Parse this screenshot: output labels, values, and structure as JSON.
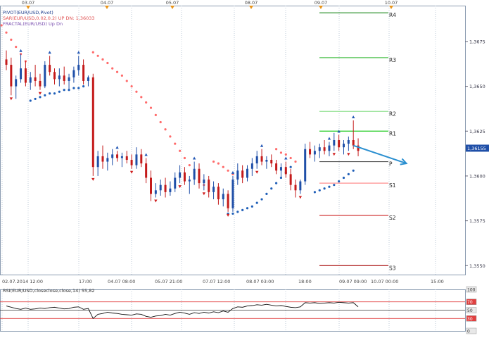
{
  "chart_data": {
    "type": "candlestick",
    "symbol": "EURUSD",
    "title_lines": [
      {
        "text": "PIVOT(EUR/USD,Pivot)",
        "color": "#1a3a8a"
      },
      {
        "text": "SAR(EUR/USD,0.02,0.2)   UP  DN: 1,36033",
        "color": "#e05050"
      },
      {
        "text": "FRACTAL(EUR/USD)  Up  Dn",
        "color": "#7a4fb0"
      }
    ],
    "top_dates": [
      "03.07",
      "04.07",
      "05.07",
      "08.07",
      "09.07",
      "10.07"
    ],
    "bottom_time_labels": [
      "02.07.2014 12:00",
      "17:00",
      "04.07 08:00",
      "05.07 21:00",
      "07.07 12:00",
      "08.07 03:00",
      "18:00",
      "09.07 09:00",
      "10.07 00:00",
      "15:00"
    ],
    "ylim": [
      1.3545,
      1.3695
    ],
    "y_ticks": [
      {
        "value": 1.3675,
        "label": "1,3675"
      },
      {
        "value": 1.365,
        "label": "1,3650"
      },
      {
        "value": 1.3625,
        "label": "1,3625"
      },
      {
        "value": 1.36,
        "label": "1,3600"
      },
      {
        "value": 1.3575,
        "label": "1,3575"
      },
      {
        "value": 1.355,
        "label": "1,3550"
      }
    ],
    "current_price": {
      "value": 1.36155,
      "label": "1,36155"
    },
    "pivot_levels": [
      {
        "name": "R4",
        "value": 1.3691,
        "color": "#1f8a1f"
      },
      {
        "name": "R3",
        "value": 1.3666,
        "color": "#4cc24c"
      },
      {
        "name": "R2",
        "value": 1.3636,
        "color": "#8fe08f"
      },
      {
        "name": "R1",
        "value": 1.3625,
        "color": "#22cc22"
      },
      {
        "name": "P",
        "value": 1.3608,
        "color": "#555555"
      },
      {
        "name": "S1",
        "value": 1.3596,
        "color": "#ff8f8f"
      },
      {
        "name": "S2",
        "value": 1.3578,
        "color": "#cc2222"
      },
      {
        "name": "S3",
        "value": 1.355,
        "color": "#aa1111"
      }
    ],
    "candles": [
      [
        1.3665,
        1.367,
        1.3659,
        1.3662
      ],
      [
        1.3662,
        1.3666,
        1.3645,
        1.365
      ],
      [
        1.365,
        1.3656,
        1.3643,
        1.3654
      ],
      [
        1.3654,
        1.3668,
        1.3652,
        1.366
      ],
      [
        1.366,
        1.3664,
        1.365,
        1.3652
      ],
      [
        1.3652,
        1.3658,
        1.3648,
        1.3655
      ],
      [
        1.3655,
        1.3662,
        1.365,
        1.3653
      ],
      [
        1.3653,
        1.3657,
        1.3648,
        1.365
      ],
      [
        1.365,
        1.3664,
        1.3649,
        1.3662
      ],
      [
        1.3662,
        1.3667,
        1.3656,
        1.3658
      ],
      [
        1.3658,
        1.366,
        1.3651,
        1.3654
      ],
      [
        1.3654,
        1.366,
        1.365,
        1.3656
      ],
      [
        1.3656,
        1.3661,
        1.3651,
        1.3653
      ],
      [
        1.3653,
        1.3657,
        1.3648,
        1.3655
      ],
      [
        1.3655,
        1.3661,
        1.3652,
        1.3659
      ],
      [
        1.3659,
        1.3667,
        1.3656,
        1.3662
      ],
      [
        1.3662,
        1.3665,
        1.3651,
        1.3653
      ],
      [
        1.3653,
        1.3656,
        1.365,
        1.3655
      ],
      [
        1.3655,
        1.3657,
        1.36,
        1.3605
      ],
      [
        1.3605,
        1.3614,
        1.36,
        1.3611
      ],
      [
        1.3611,
        1.3617,
        1.3604,
        1.3608
      ],
      [
        1.3608,
        1.3613,
        1.3603,
        1.361
      ],
      [
        1.361,
        1.3615,
        1.3606,
        1.3612
      ],
      [
        1.3612,
        1.3614,
        1.3608,
        1.361
      ],
      [
        1.361,
        1.3613,
        1.3605,
        1.3611
      ],
      [
        1.3611,
        1.3614,
        1.3607,
        1.3609
      ],
      [
        1.3609,
        1.3612,
        1.3604,
        1.3606
      ],
      [
        1.3606,
        1.3616,
        1.3604,
        1.3612
      ],
      [
        1.3612,
        1.3615,
        1.3605,
        1.3607
      ],
      [
        1.3607,
        1.361,
        1.3596,
        1.3599
      ],
      [
        1.3599,
        1.3603,
        1.3586,
        1.359
      ],
      [
        1.359,
        1.3596,
        1.3588,
        1.3592
      ],
      [
        1.3592,
        1.3598,
        1.3589,
        1.3595
      ],
      [
        1.3595,
        1.3599,
        1.3588,
        1.3591
      ],
      [
        1.3591,
        1.3597,
        1.3589,
        1.3593
      ],
      [
        1.3593,
        1.3602,
        1.3591,
        1.3599
      ],
      [
        1.3599,
        1.3606,
        1.3596,
        1.3602
      ],
      [
        1.3602,
        1.3605,
        1.3595,
        1.3597
      ],
      [
        1.3597,
        1.36,
        1.359,
        1.3598
      ],
      [
        1.3598,
        1.3608,
        1.3595,
        1.3604
      ],
      [
        1.3604,
        1.3607,
        1.3593,
        1.3596
      ],
      [
        1.3596,
        1.3601,
        1.3592,
        1.3598
      ],
      [
        1.3598,
        1.36,
        1.3588,
        1.3591
      ],
      [
        1.3591,
        1.3597,
        1.3587,
        1.3594
      ],
      [
        1.3594,
        1.3596,
        1.3584,
        1.3587
      ],
      [
        1.3587,
        1.3593,
        1.3583,
        1.359
      ],
      [
        1.359,
        1.3592,
        1.358,
        1.3582
      ],
      [
        1.3582,
        1.36,
        1.358,
        1.3598
      ],
      [
        1.3598,
        1.3607,
        1.3595,
        1.3603
      ],
      [
        1.3603,
        1.3606,
        1.3596,
        1.3599
      ],
      [
        1.3599,
        1.3606,
        1.3597,
        1.3604
      ],
      [
        1.3604,
        1.361,
        1.36,
        1.3607
      ],
      [
        1.3607,
        1.3614,
        1.3604,
        1.3611
      ],
      [
        1.3611,
        1.3615,
        1.3606,
        1.3608
      ],
      [
        1.3608,
        1.3611,
        1.3604,
        1.3609
      ],
      [
        1.3609,
        1.3612,
        1.3605,
        1.3607
      ],
      [
        1.3607,
        1.3609,
        1.3601,
        1.3603
      ],
      [
        1.3603,
        1.3607,
        1.3599,
        1.3605
      ],
      [
        1.3605,
        1.3608,
        1.3599,
        1.3601
      ],
      [
        1.3601,
        1.3604,
        1.3592,
        1.3595
      ],
      [
        1.3595,
        1.3598,
        1.3588,
        1.3592
      ],
      [
        1.3592,
        1.3598,
        1.359,
        1.3597
      ],
      [
        1.3597,
        1.3618,
        1.3595,
        1.3615
      ],
      [
        1.3615,
        1.3619,
        1.361,
        1.3612
      ],
      [
        1.3612,
        1.3617,
        1.3608,
        1.3614
      ],
      [
        1.3614,
        1.3618,
        1.361,
        1.3616
      ],
      [
        1.3616,
        1.362,
        1.3612,
        1.3614
      ],
      [
        1.3614,
        1.3619,
        1.3611,
        1.3617
      ],
      [
        1.3617,
        1.3624,
        1.3614,
        1.362
      ],
      [
        1.362,
        1.3623,
        1.3614,
        1.3616
      ],
      [
        1.3616,
        1.362,
        1.3612,
        1.3618
      ],
      [
        1.3618,
        1.3622,
        1.3614,
        1.362
      ],
      [
        1.362,
        1.3631,
        1.3615,
        1.3617
      ],
      [
        1.3617,
        1.3621,
        1.3611,
        1.3614
      ]
    ],
    "sar_up_dots": [
      [
        18,
        1.3669
      ],
      [
        19,
        1.3667
      ],
      [
        20,
        1.3665
      ],
      [
        21,
        1.3663
      ],
      [
        22,
        1.366
      ],
      [
        23,
        1.3658
      ],
      [
        24,
        1.3656
      ],
      [
        25,
        1.3653
      ],
      [
        26,
        1.365
      ],
      [
        27,
        1.3647
      ],
      [
        28,
        1.3644
      ],
      [
        29,
        1.3641
      ],
      [
        30,
        1.3638
      ],
      [
        31,
        1.3634
      ],
      [
        32,
        1.363
      ],
      [
        33,
        1.3626
      ],
      [
        34,
        1.3622
      ],
      [
        35,
        1.3618
      ],
      [
        36,
        1.3614
      ],
      [
        37,
        1.361
      ],
      [
        38,
        1.3606
      ],
      [
        39,
        1.3602
      ],
      [
        40,
        1.3598
      ],
      [
        41,
        1.3595
      ],
      [
        -1,
        1.3684
      ],
      [
        0,
        1.368
      ],
      [
        1,
        1.3676
      ],
      [
        2,
        1.3672
      ],
      [
        3,
        1.3668
      ],
      [
        4,
        1.3664
      ],
      [
        43,
        1.3608
      ],
      [
        44,
        1.3607
      ],
      [
        45,
        1.3605
      ],
      [
        46,
        1.3603
      ],
      [
        47,
        1.3601
      ],
      [
        48,
        1.3599
      ],
      [
        56,
        1.3615
      ],
      [
        57,
        1.3613
      ],
      [
        58,
        1.3612
      ],
      [
        59,
        1.361
      ],
      [
        60,
        1.3608
      ]
    ],
    "sar_down_dots": [
      [
        5,
        1.3642
      ],
      [
        6,
        1.3643
      ],
      [
        7,
        1.3644
      ],
      [
        8,
        1.3645
      ],
      [
        9,
        1.3646
      ],
      [
        10,
        1.3646
      ],
      [
        11,
        1.3647
      ],
      [
        12,
        1.3648
      ],
      [
        13,
        1.3648
      ],
      [
        14,
        1.3649
      ],
      [
        15,
        1.3649
      ],
      [
        16,
        1.365
      ],
      [
        46,
        1.3579
      ],
      [
        47,
        1.3579
      ],
      [
        48,
        1.358
      ],
      [
        49,
        1.3581
      ],
      [
        50,
        1.3582
      ],
      [
        51,
        1.3583
      ],
      [
        52,
        1.3585
      ],
      [
        53,
        1.3587
      ],
      [
        54,
        1.359
      ],
      [
        55,
        1.3593
      ],
      [
        56,
        1.3596
      ],
      [
        57,
        1.3599
      ],
      [
        58,
        1.3602
      ],
      [
        59,
        1.3605
      ],
      [
        64,
        1.3591
      ],
      [
        65,
        1.3592
      ],
      [
        66,
        1.3593
      ],
      [
        67,
        1.3594
      ],
      [
        68,
        1.3595
      ],
      [
        69,
        1.3597
      ],
      [
        70,
        1.3599
      ],
      [
        71,
        1.3601
      ],
      [
        72,
        1.3603
      ]
    ],
    "fractal_up": [
      3,
      9,
      15,
      23,
      29,
      39,
      47,
      53,
      58,
      67,
      69,
      72
    ],
    "fractal_down": [
      1,
      7,
      18,
      26,
      31,
      36,
      41,
      46,
      52,
      61,
      68,
      71
    ],
    "forecast_arrow": [
      [
        72,
        1.3617
      ],
      [
        83,
        1.3607
      ]
    ],
    "rsi": {
      "label": "RSI(EUR/USD,closeclose,close,14) 55,82",
      "levels": [
        70,
        50,
        30
      ],
      "scale": [
        100,
        0
      ],
      "scale_labels": [
        "100",
        "70",
        "50",
        "30",
        "0"
      ],
      "values": [
        60,
        57,
        54,
        52,
        55,
        52,
        53,
        55,
        54,
        56,
        57,
        55,
        53,
        54,
        57,
        58,
        52,
        54,
        30,
        40,
        42,
        45,
        43,
        42,
        40,
        39,
        38,
        41,
        40,
        35,
        33,
        36,
        37,
        40,
        38,
        42,
        45,
        43,
        40,
        44,
        42,
        45,
        43,
        46,
        44,
        48,
        45,
        54,
        58,
        57,
        60,
        61,
        63,
        62,
        64,
        62,
        60,
        61,
        59,
        57,
        56,
        58,
        68,
        67,
        68,
        66,
        67,
        68,
        67,
        69,
        68,
        67,
        68,
        58
      ]
    }
  }
}
